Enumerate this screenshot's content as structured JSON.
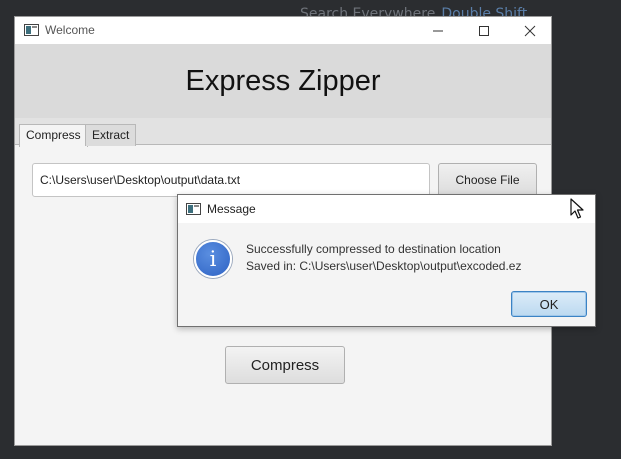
{
  "background": {
    "hint_text": "Search Everywhere",
    "hint_key": "Double Shift"
  },
  "window": {
    "title": "Welcome",
    "controls": {
      "minimize": "—",
      "maximize": "☐",
      "close": "✕"
    }
  },
  "header": {
    "title": "Express Zipper"
  },
  "tabs": [
    {
      "label": "Compress",
      "selected": true
    },
    {
      "label": "Extract",
      "selected": false
    }
  ],
  "compress_tab": {
    "file_path": "C:\\Users\\user\\Desktop\\output\\data.txt",
    "choose_file_label": "Choose File",
    "compress_label": "Compress"
  },
  "dialog": {
    "title": "Message",
    "icon": "info-icon",
    "info_glyph": "i",
    "message_line1": "Successfully compressed to destination location",
    "message_line2": "Saved in: C:\\Users\\user\\Desktop\\output\\excoded.ez",
    "ok_label": "OK"
  },
  "colors": {
    "accent_button_border": "#3b83c4",
    "info_icon": "#2e63c4",
    "header_background": "#dadada"
  }
}
